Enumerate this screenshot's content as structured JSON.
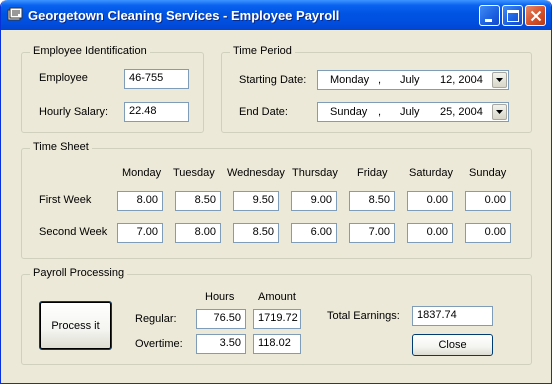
{
  "window": {
    "title": "Georgetown Cleaning Services - Employee Payroll"
  },
  "employee": {
    "legend": "Employee Identification",
    "number_label": "Employee",
    "number_value": "46-755",
    "salary_label": "Hourly Salary:",
    "salary_value": "22.48"
  },
  "time_period": {
    "legend": "Time Period",
    "start_label": "Starting Date:",
    "start_day": "Monday",
    "start_month": "July",
    "start_date": "12, 2004",
    "end_label": "End Date:",
    "end_day": "Sunday",
    "end_month": "July",
    "end_date": "25, 2004",
    "separator": ","
  },
  "timesheet": {
    "legend": "Time Sheet",
    "days": [
      "Monday",
      "Tuesday",
      "Wednesday",
      "Thursday",
      "Friday",
      "Saturday",
      "Sunday"
    ],
    "weeks": [
      {
        "label": "First Week",
        "hours": [
          "8.00",
          "8.50",
          "9.50",
          "9.00",
          "8.50",
          "0.00",
          "0.00"
        ]
      },
      {
        "label": "Second Week",
        "hours": [
          "7.00",
          "8.00",
          "8.50",
          "6.00",
          "7.00",
          "0.00",
          "0.00"
        ]
      }
    ]
  },
  "payroll": {
    "legend": "Payroll Processing",
    "process_button": "Process it",
    "hours_header": "Hours",
    "amount_header": "Amount",
    "regular_label": "Regular:",
    "regular_hours": "76.50",
    "regular_amount": "1719.72",
    "overtime_label": "Overtime:",
    "overtime_hours": "3.50",
    "overtime_amount": "118.02",
    "total_label": "Total Earnings:",
    "total_value": "1837.74",
    "close_button": "Close"
  },
  "icons": [
    "app-icon",
    "minimize-icon",
    "maximize-icon",
    "close-icon",
    "chevron-down-icon"
  ]
}
